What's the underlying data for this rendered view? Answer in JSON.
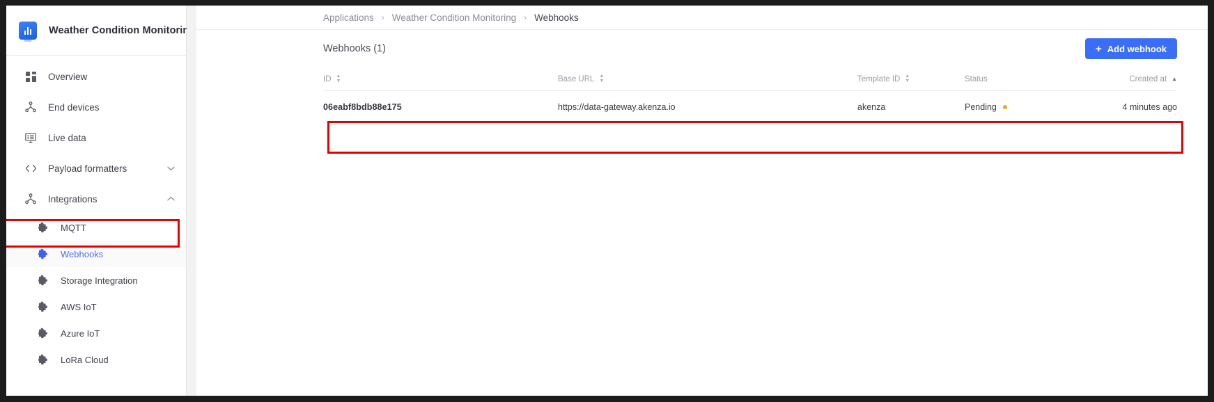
{
  "app": {
    "title": "Weather Condition Monitoring",
    "logo_icon": "chart-monitor-icon"
  },
  "sidebar": {
    "items": [
      {
        "label": "Overview",
        "icon": "grid-icon",
        "level": 0,
        "active": false,
        "chevron": null
      },
      {
        "label": "End devices",
        "icon": "sitemap-icon",
        "level": 0,
        "active": false,
        "chevron": null
      },
      {
        "label": "Live data",
        "icon": "monitor-icon",
        "level": 0,
        "active": false,
        "chevron": null
      },
      {
        "label": "Payload formatters",
        "icon": "code-icon",
        "level": 0,
        "active": false,
        "chevron": "chevron-down-icon"
      },
      {
        "label": "Integrations",
        "icon": "sitemap-icon",
        "level": 0,
        "active": false,
        "chevron": "chevron-up-icon"
      },
      {
        "label": "MQTT",
        "icon": "puzzle-icon",
        "level": 1,
        "active": false,
        "chevron": null
      },
      {
        "label": "Webhooks",
        "icon": "puzzle-icon",
        "level": 1,
        "active": true,
        "chevron": null
      },
      {
        "label": "Storage Integration",
        "icon": "puzzle-icon",
        "level": 1,
        "active": false,
        "chevron": null
      },
      {
        "label": "AWS IoT",
        "icon": "puzzle-icon",
        "level": 1,
        "active": false,
        "chevron": null
      },
      {
        "label": "Azure IoT",
        "icon": "puzzle-icon",
        "level": 1,
        "active": false,
        "chevron": null
      },
      {
        "label": "LoRa Cloud",
        "icon": "puzzle-icon",
        "level": 1,
        "active": false,
        "chevron": null
      }
    ]
  },
  "breadcrumb": {
    "items": [
      {
        "label": "Applications",
        "current": false
      },
      {
        "label": "Weather Condition Monitoring",
        "current": false
      },
      {
        "label": "Webhooks",
        "current": true
      }
    ],
    "separator": "›"
  },
  "main": {
    "page_title": "Webhooks (1)",
    "add_button": {
      "label": "Add webhook",
      "icon": "plus-icon",
      "color": "#3b6ef6"
    }
  },
  "table": {
    "columns": [
      {
        "key": "id",
        "label": "ID",
        "sort": "both"
      },
      {
        "key": "url",
        "label": "Base URL",
        "sort": "both"
      },
      {
        "key": "template",
        "label": "Template ID",
        "sort": "both"
      },
      {
        "key": "status",
        "label": "Status",
        "sort": "none"
      },
      {
        "key": "created",
        "label": "Created at",
        "sort": "asc"
      }
    ],
    "rows": [
      {
        "id": "06eabf8bdb88e175",
        "url": "https://data-gateway.akenza.io",
        "template": "akenza",
        "status": "Pending",
        "status_color": "#f5a623",
        "created": "4 minutes ago"
      }
    ]
  },
  "annotations": {
    "highlight_color": "#e60000",
    "boxes": [
      {
        "name": "webhooks-nav-highlight"
      },
      {
        "name": "webhook-row-highlight"
      }
    ]
  }
}
